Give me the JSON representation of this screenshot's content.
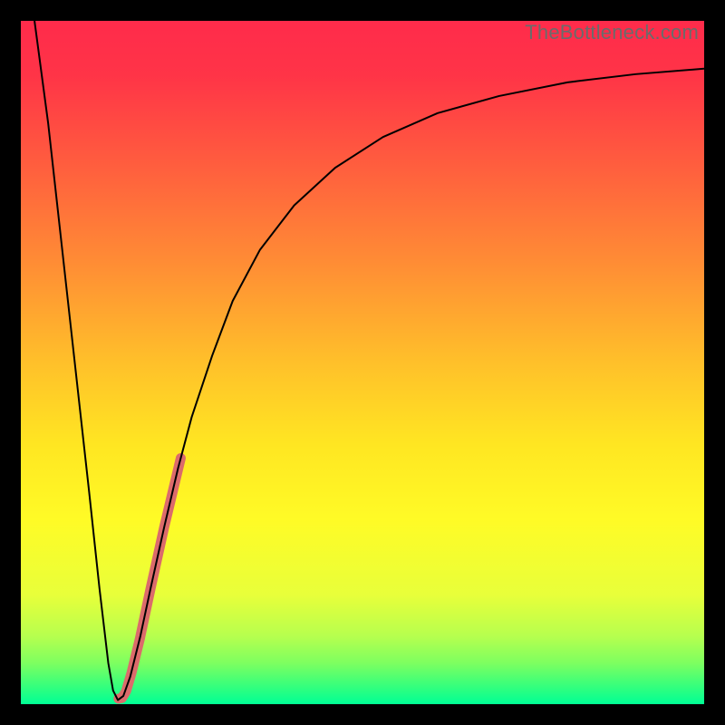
{
  "watermark": "TheBottleneck.com",
  "chart_data": {
    "type": "line",
    "title": "",
    "xlabel": "",
    "ylabel": "",
    "xlim": [
      0,
      100
    ],
    "ylim": [
      0,
      100
    ],
    "grid": false,
    "background_gradient": {
      "stops": [
        {
          "offset": 0.0,
          "color": "#ff2b4b"
        },
        {
          "offset": 0.08,
          "color": "#ff3447"
        },
        {
          "offset": 0.2,
          "color": "#ff5a3f"
        },
        {
          "offset": 0.35,
          "color": "#ff8b35"
        },
        {
          "offset": 0.5,
          "color": "#ffc02a"
        },
        {
          "offset": 0.62,
          "color": "#ffe622"
        },
        {
          "offset": 0.73,
          "color": "#fffb26"
        },
        {
          "offset": 0.84,
          "color": "#e8ff3a"
        },
        {
          "offset": 0.9,
          "color": "#b7ff4e"
        },
        {
          "offset": 0.94,
          "color": "#7dff60"
        },
        {
          "offset": 0.97,
          "color": "#3dff79"
        },
        {
          "offset": 1.0,
          "color": "#00ff95"
        }
      ]
    },
    "series": [
      {
        "name": "bottleneck-curve",
        "type": "line",
        "stroke": "#000000",
        "stroke_width": 2,
        "points": [
          {
            "x": 2.0,
            "y": 100.0
          },
          {
            "x": 4.0,
            "y": 85.0
          },
          {
            "x": 6.0,
            "y": 67.0
          },
          {
            "x": 8.0,
            "y": 49.0
          },
          {
            "x": 10.0,
            "y": 31.0
          },
          {
            "x": 11.5,
            "y": 17.0
          },
          {
            "x": 12.8,
            "y": 6.0
          },
          {
            "x": 13.5,
            "y": 2.0
          },
          {
            "x": 14.2,
            "y": 0.6
          },
          {
            "x": 15.0,
            "y": 1.2
          },
          {
            "x": 16.0,
            "y": 4.0
          },
          {
            "x": 17.5,
            "y": 10.0
          },
          {
            "x": 19.0,
            "y": 17.0
          },
          {
            "x": 21.0,
            "y": 26.0
          },
          {
            "x": 23.0,
            "y": 34.5
          },
          {
            "x": 25.0,
            "y": 42.0
          },
          {
            "x": 28.0,
            "y": 51.0
          },
          {
            "x": 31.0,
            "y": 59.0
          },
          {
            "x": 35.0,
            "y": 66.5
          },
          {
            "x": 40.0,
            "y": 73.0
          },
          {
            "x": 46.0,
            "y": 78.5
          },
          {
            "x": 53.0,
            "y": 83.0
          },
          {
            "x": 61.0,
            "y": 86.5
          },
          {
            "x": 70.0,
            "y": 89.0
          },
          {
            "x": 80.0,
            "y": 91.0
          },
          {
            "x": 90.0,
            "y": 92.2
          },
          {
            "x": 100.0,
            "y": 93.0
          }
        ]
      },
      {
        "name": "highlight-segment",
        "type": "line",
        "stroke": "#db6b6b",
        "stroke_width": 11,
        "linecap": "round",
        "points": [
          {
            "x": 14.3,
            "y": 0.8
          },
          {
            "x": 14.8,
            "y": 0.9
          },
          {
            "x": 15.4,
            "y": 1.9
          },
          {
            "x": 16.2,
            "y": 4.6
          },
          {
            "x": 17.4,
            "y": 9.5
          },
          {
            "x": 19.0,
            "y": 17.0
          },
          {
            "x": 21.0,
            "y": 26.0
          },
          {
            "x": 23.4,
            "y": 36.0
          }
        ]
      }
    ]
  }
}
